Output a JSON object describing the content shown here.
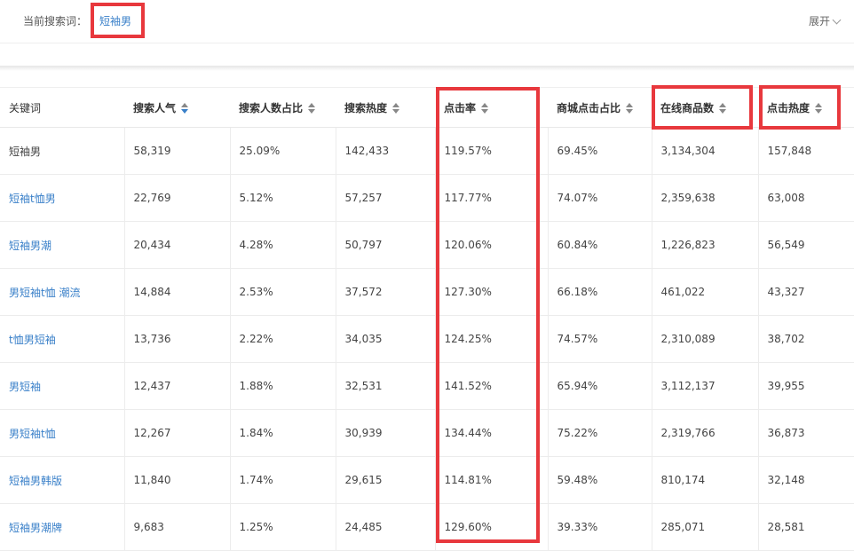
{
  "search": {
    "label": "当前搜索词：",
    "term": "短袖男",
    "expand_label": "展开"
  },
  "table": {
    "headers": [
      "关键词",
      "搜索人气",
      "搜索人数占比",
      "搜索热度",
      "点击率",
      "商城点击占比",
      "在线商品数",
      "点击热度"
    ],
    "rows": [
      {
        "keyword": "短袖男",
        "popularity": "58,319",
        "search_share": "25.09%",
        "search_heat": "142,433",
        "ctr": "119.57%",
        "mall_click_share": "69.45%",
        "online_items": "3,134,304",
        "click_heat": "157,848"
      },
      {
        "keyword": "短袖t恤男",
        "popularity": "22,769",
        "search_share": "5.12%",
        "search_heat": "57,257",
        "ctr": "117.77%",
        "mall_click_share": "74.07%",
        "online_items": "2,359,638",
        "click_heat": "63,008"
      },
      {
        "keyword": "短袖男潮",
        "popularity": "20,434",
        "search_share": "4.28%",
        "search_heat": "50,797",
        "ctr": "120.06%",
        "mall_click_share": "60.84%",
        "online_items": "1,226,823",
        "click_heat": "56,549"
      },
      {
        "keyword": "男短袖t恤 潮流",
        "popularity": "14,884",
        "search_share": "2.53%",
        "search_heat": "37,572",
        "ctr": "127.30%",
        "mall_click_share": "66.18%",
        "online_items": "461,022",
        "click_heat": "43,327"
      },
      {
        "keyword": "t恤男短袖",
        "popularity": "13,736",
        "search_share": "2.22%",
        "search_heat": "34,035",
        "ctr": "124.25%",
        "mall_click_share": "74.57%",
        "online_items": "2,310,089",
        "click_heat": "38,702"
      },
      {
        "keyword": "男短袖",
        "popularity": "12,437",
        "search_share": "1.88%",
        "search_heat": "32,531",
        "ctr": "141.52%",
        "mall_click_share": "65.94%",
        "online_items": "3,112,137",
        "click_heat": "39,955"
      },
      {
        "keyword": "男短袖t恤",
        "popularity": "12,267",
        "search_share": "1.84%",
        "search_heat": "30,939",
        "ctr": "134.44%",
        "mall_click_share": "75.22%",
        "online_items": "2,319,766",
        "click_heat": "36,873"
      },
      {
        "keyword": "短袖男韩版",
        "popularity": "11,840",
        "search_share": "1.74%",
        "search_heat": "29,615",
        "ctr": "114.81%",
        "mall_click_share": "59.48%",
        "online_items": "810,174",
        "click_heat": "32,148"
      },
      {
        "keyword": "短袖男潮牌",
        "popularity": "9,683",
        "search_share": "1.25%",
        "search_heat": "24,485",
        "ctr": "129.60%",
        "mall_click_share": "39.33%",
        "online_items": "285,071",
        "click_heat": "28,581"
      }
    ]
  },
  "colors": {
    "link": "#3a80c9",
    "highlight": "#e8383d",
    "sort_active": "#3a80c9"
  }
}
